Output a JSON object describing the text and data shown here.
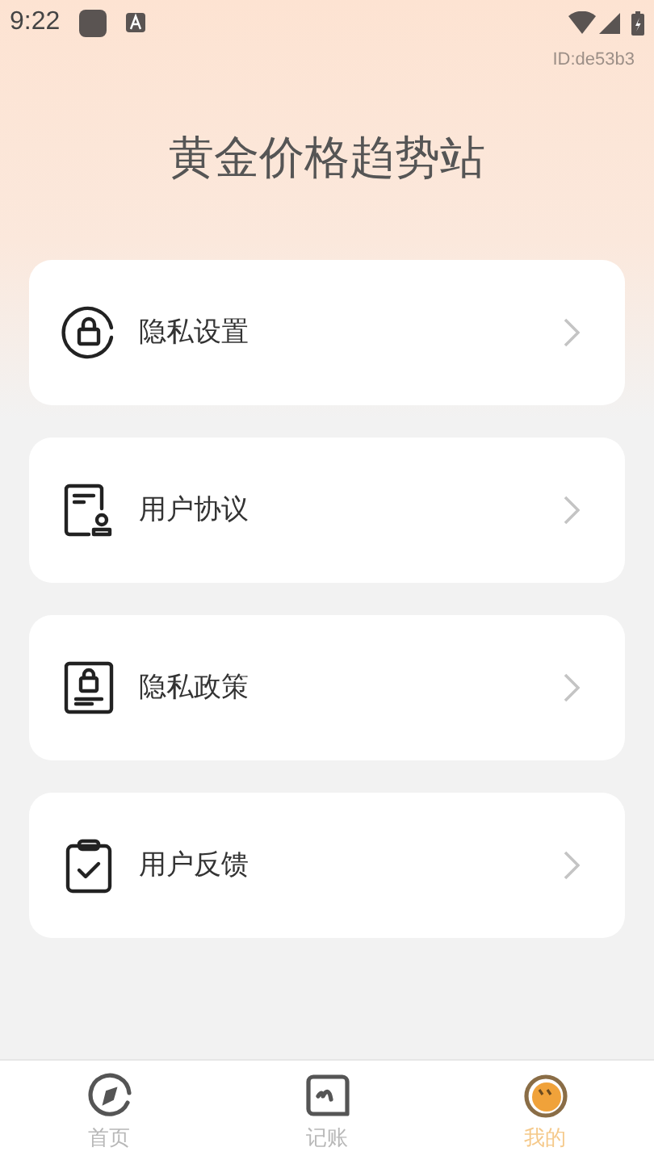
{
  "status_bar": {
    "time": "9:22"
  },
  "user_id": "ID:de53b3",
  "title": "黄金价格趋势站",
  "menu_items": [
    {
      "kind": "privacy_settings",
      "label": "隐私设置"
    },
    {
      "kind": "agreement",
      "label": "用户协议"
    },
    {
      "kind": "policy",
      "label": "隐私政策"
    },
    {
      "kind": "feedback",
      "label": "用户反馈"
    }
  ],
  "tab_bar": [
    {
      "kind": "home",
      "label": "首页",
      "selected": false
    },
    {
      "kind": "ledger",
      "label": "记账",
      "selected": false
    },
    {
      "kind": "mine",
      "label": "我的",
      "selected": true
    }
  ]
}
